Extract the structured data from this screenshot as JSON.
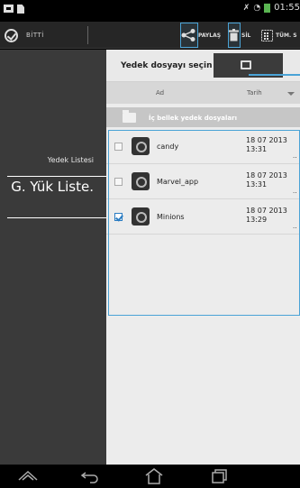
{
  "status_bar": {
    "time": "01:55"
  },
  "action_bar": {
    "done_label": "BİTTİ",
    "share_label": "PAYLAŞ",
    "delete_label": "SİL",
    "select_all_label": "TÜM. S"
  },
  "left_panel": {
    "title": "Yedek Listesi",
    "name": "G. Yük Liste."
  },
  "right_panel": {
    "title": "Yedek dosyayı seçin",
    "columns": {
      "name": "Ad",
      "date": "Tarih"
    },
    "section_label": "İç bellek yedek dosyaları",
    "rows": [
      {
        "name": "candy",
        "date": "18 07 2013",
        "time": "13:31",
        "ellipsis": "..",
        "checked": false
      },
      {
        "name": "Marvel_app",
        "date": "18 07 2013",
        "time": "13:31",
        "ellipsis": "..",
        "checked": false
      },
      {
        "name": "Minions",
        "date": "18 07 2013",
        "time": "13:29",
        "ellipsis": "..",
        "checked": true
      }
    ]
  },
  "colors": {
    "accent": "#4aa3d6",
    "panel_dark": "#3a3a3a",
    "panel_light": "#ececec"
  },
  "icons": [
    "check-circle-icon",
    "share-icon",
    "trash-icon",
    "select-all-icon",
    "folder-icon",
    "app-icon",
    "back-icon",
    "home-icon",
    "recents-icon"
  ]
}
